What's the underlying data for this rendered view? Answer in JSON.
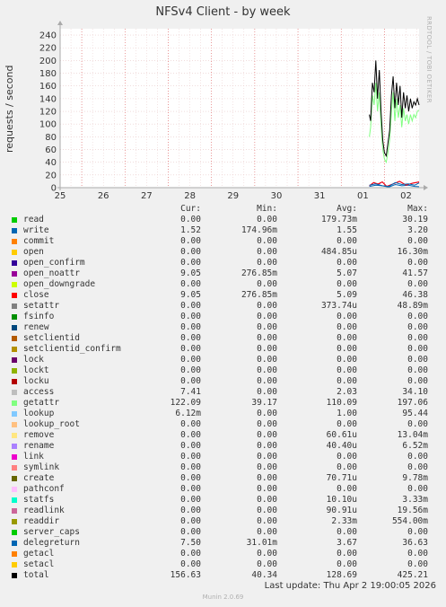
{
  "title": "NFSv4 Client - by week",
  "ylabel": "requests / second",
  "watermark": "RRDTOOL / TOBI OETIKER",
  "footer": {
    "last_update": "Last update: Thu Apr  2 19:00:05 2026",
    "munin": "Munin 2.0.69"
  },
  "legend_headers": {
    "cur": "Cur:",
    "min": "Min:",
    "avg": "Avg:",
    "max": "Max:"
  },
  "legend": [
    {
      "name": "read",
      "color": "#00cc00",
      "cur": "0.00",
      "min": "0.00",
      "avg": "179.73m",
      "max": "30.19"
    },
    {
      "name": "write",
      "color": "#0066b3",
      "cur": "1.52",
      "min": "174.96m",
      "avg": "1.55",
      "max": "3.20"
    },
    {
      "name": "commit",
      "color": "#ff8000",
      "cur": "0.00",
      "min": "0.00",
      "avg": "0.00",
      "max": "0.00"
    },
    {
      "name": "open",
      "color": "#ffcc00",
      "cur": "0.00",
      "min": "0.00",
      "avg": "484.85u",
      "max": "16.30m"
    },
    {
      "name": "open_confirm",
      "color": "#330099",
      "cur": "0.00",
      "min": "0.00",
      "avg": "0.00",
      "max": "0.00"
    },
    {
      "name": "open_noattr",
      "color": "#990099",
      "cur": "9.05",
      "min": "276.85m",
      "avg": "5.07",
      "max": "41.57"
    },
    {
      "name": "open_downgrade",
      "color": "#ccff00",
      "cur": "0.00",
      "min": "0.00",
      "avg": "0.00",
      "max": "0.00"
    },
    {
      "name": "close",
      "color": "#ff0000",
      "cur": "9.05",
      "min": "276.85m",
      "avg": "5.09",
      "max": "46.38"
    },
    {
      "name": "setattr",
      "color": "#808080",
      "cur": "0.00",
      "min": "0.00",
      "avg": "373.74u",
      "max": "48.89m"
    },
    {
      "name": "fsinfo",
      "color": "#008f00",
      "cur": "0.00",
      "min": "0.00",
      "avg": "0.00",
      "max": "0.00"
    },
    {
      "name": "renew",
      "color": "#00487d",
      "cur": "0.00",
      "min": "0.00",
      "avg": "0.00",
      "max": "0.00"
    },
    {
      "name": "setclientid",
      "color": "#b35a00",
      "cur": "0.00",
      "min": "0.00",
      "avg": "0.00",
      "max": "0.00"
    },
    {
      "name": "setclientid_confirm",
      "color": "#b38f00",
      "cur": "0.00",
      "min": "0.00",
      "avg": "0.00",
      "max": "0.00"
    },
    {
      "name": "lock",
      "color": "#6b006b",
      "cur": "0.00",
      "min": "0.00",
      "avg": "0.00",
      "max": "0.00"
    },
    {
      "name": "lockt",
      "color": "#8fb300",
      "cur": "0.00",
      "min": "0.00",
      "avg": "0.00",
      "max": "0.00"
    },
    {
      "name": "locku",
      "color": "#b30000",
      "cur": "0.00",
      "min": "0.00",
      "avg": "0.00",
      "max": "0.00"
    },
    {
      "name": "access",
      "color": "#bebebe",
      "cur": "7.41",
      "min": "0.00",
      "avg": "2.03",
      "max": "34.10"
    },
    {
      "name": "getattr",
      "color": "#80ff80",
      "cur": "122.09",
      "min": "39.17",
      "avg": "110.09",
      "max": "197.06"
    },
    {
      "name": "lookup",
      "color": "#80c9ff",
      "cur": "6.12m",
      "min": "0.00",
      "avg": "1.00",
      "max": "95.44"
    },
    {
      "name": "lookup_root",
      "color": "#ffc080",
      "cur": "0.00",
      "min": "0.00",
      "avg": "0.00",
      "max": "0.00"
    },
    {
      "name": "remove",
      "color": "#ffe680",
      "cur": "0.00",
      "min": "0.00",
      "avg": "60.61u",
      "max": "13.04m"
    },
    {
      "name": "rename",
      "color": "#aa80ff",
      "cur": "0.00",
      "min": "0.00",
      "avg": "40.40u",
      "max": "6.52m"
    },
    {
      "name": "link",
      "color": "#ee00cc",
      "cur": "0.00",
      "min": "0.00",
      "avg": "0.00",
      "max": "0.00"
    },
    {
      "name": "symlink",
      "color": "#ff8080",
      "cur": "0.00",
      "min": "0.00",
      "avg": "0.00",
      "max": "0.00"
    },
    {
      "name": "create",
      "color": "#666600",
      "cur": "0.00",
      "min": "0.00",
      "avg": "70.71u",
      "max": "9.78m"
    },
    {
      "name": "pathconf",
      "color": "#ffbfff",
      "cur": "0.00",
      "min": "0.00",
      "avg": "0.00",
      "max": "0.00"
    },
    {
      "name": "statfs",
      "color": "#00ffcc",
      "cur": "0.00",
      "min": "0.00",
      "avg": "10.10u",
      "max": "3.33m"
    },
    {
      "name": "readlink",
      "color": "#cc6699",
      "cur": "0.00",
      "min": "0.00",
      "avg": "90.91u",
      "max": "19.56m"
    },
    {
      "name": "readdir",
      "color": "#999900",
      "cur": "0.00",
      "min": "0.00",
      "avg": "2.33m",
      "max": "554.00m"
    },
    {
      "name": "server_caps",
      "color": "#00cc00",
      "cur": "0.00",
      "min": "0.00",
      "avg": "0.00",
      "max": "0.00"
    },
    {
      "name": "delegreturn",
      "color": "#0066b3",
      "cur": "7.50",
      "min": "31.01m",
      "avg": "3.67",
      "max": "36.63"
    },
    {
      "name": "getacl",
      "color": "#ff8000",
      "cur": "0.00",
      "min": "0.00",
      "avg": "0.00",
      "max": "0.00"
    },
    {
      "name": "setacl",
      "color": "#ffcc00",
      "cur": "0.00",
      "min": "0.00",
      "avg": "0.00",
      "max": "0.00"
    },
    {
      "name": "total",
      "color": "#000000",
      "cur": "156.63",
      "min": "40.34",
      "avg": "128.69",
      "max": "425.21"
    }
  ],
  "chart_data": {
    "type": "line",
    "title": "NFSv4 Client - by week",
    "ylabel": "requests / second",
    "xlabel": "",
    "x_ticks": [
      "25",
      "26",
      "27",
      "28",
      "29",
      "30",
      "31",
      "01",
      "02"
    ],
    "ylim": [
      0,
      250
    ],
    "y_ticks": [
      0,
      20,
      40,
      60,
      80,
      100,
      120,
      140,
      160,
      180,
      200,
      220,
      240
    ],
    "grid": true,
    "x_range_days": [
      0,
      8.3
    ],
    "series": [
      {
        "name": "total",
        "color": "#000000",
        "x": [
          7.15,
          7.18,
          7.22,
          7.26,
          7.3,
          7.34,
          7.38,
          7.42,
          7.46,
          7.5,
          7.54,
          7.58,
          7.62,
          7.66,
          7.7,
          7.74,
          7.78,
          7.82,
          7.86,
          7.9,
          7.94,
          7.98,
          8.02,
          8.06,
          8.1,
          8.14,
          8.18,
          8.22,
          8.26,
          8.3
        ],
        "y": [
          115,
          105,
          165,
          150,
          200,
          140,
          185,
          120,
          75,
          55,
          50,
          70,
          90,
          145,
          175,
          125,
          165,
          130,
          160,
          110,
          150,
          125,
          145,
          120,
          140,
          125,
          135,
          130,
          140,
          130
        ]
      },
      {
        "name": "getattr",
        "color": "#80ff80",
        "x": [
          7.15,
          7.18,
          7.22,
          7.26,
          7.3,
          7.34,
          7.38,
          7.42,
          7.46,
          7.5,
          7.54,
          7.58,
          7.62,
          7.66,
          7.7,
          7.74,
          7.78,
          7.82,
          7.86,
          7.9,
          7.94,
          7.98,
          8.02,
          8.06,
          8.1,
          8.14,
          8.18,
          8.22,
          8.26,
          8.3
        ],
        "y": [
          80,
          95,
          145,
          130,
          165,
          120,
          150,
          100,
          60,
          45,
          40,
          55,
          75,
          120,
          150,
          105,
          140,
          110,
          130,
          95,
          125,
          105,
          115,
          100,
          115,
          105,
          115,
          110,
          120,
          122
        ]
      },
      {
        "name": "write",
        "color": "#0066b3",
        "x": [
          7.15,
          7.3,
          7.45,
          7.6,
          7.75,
          7.9,
          8.05,
          8.2,
          8.3
        ],
        "y": [
          2,
          4,
          3,
          1,
          5,
          3,
          4,
          2,
          1.5
        ]
      },
      {
        "name": "open_noattr",
        "color": "#990099",
        "x": [
          7.15,
          7.25,
          7.35,
          7.45,
          7.55,
          7.7,
          7.85,
          8.0,
          8.15,
          8.3
        ],
        "y": [
          3,
          8,
          5,
          9,
          2,
          6,
          10,
          4,
          7,
          9
        ]
      },
      {
        "name": "close",
        "color": "#ff0000",
        "x": [
          7.15,
          7.25,
          7.35,
          7.45,
          7.55,
          7.7,
          7.85,
          8.0,
          8.15,
          8.3
        ],
        "y": [
          3,
          8,
          6,
          9,
          2,
          6,
          10,
          4,
          7,
          9
        ]
      },
      {
        "name": "delegreturn",
        "color": "#0066b3",
        "x": [
          7.15,
          7.3,
          7.45,
          7.6,
          7.75,
          7.9,
          8.05,
          8.2,
          8.3
        ],
        "y": [
          4,
          6,
          3,
          2,
          8,
          5,
          6,
          4,
          7.5
        ]
      }
    ]
  }
}
